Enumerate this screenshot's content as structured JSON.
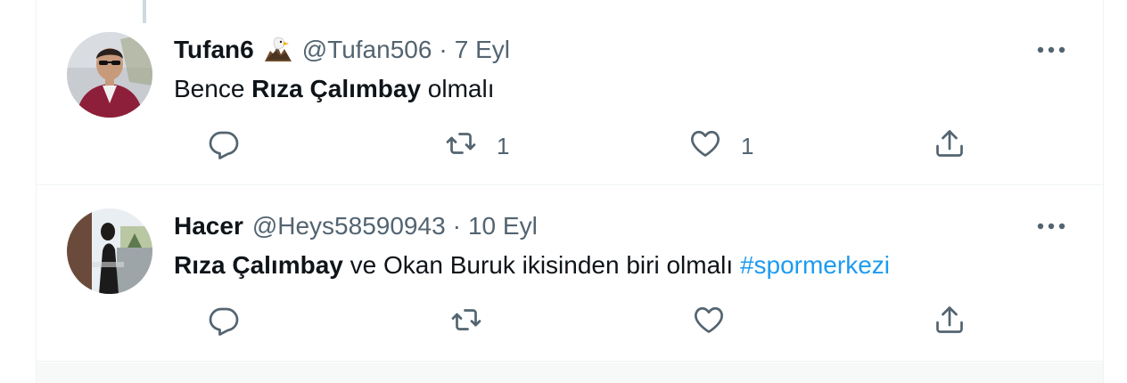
{
  "tweets": [
    {
      "name": "Tufan6",
      "handle": "@Tufan506",
      "separator": "·",
      "date": "7 Eyl",
      "text": {
        "pre": "Bence ",
        "bold": "Rıza Çalımbay",
        "post": " olmalı",
        "hashtag": ""
      },
      "actions": {
        "reply_count": "",
        "retweet_count": "1",
        "like_count": "1"
      },
      "emoji": "eagle-emoji"
    },
    {
      "name": "Hacer",
      "handle": "@Heys58590943",
      "separator": "·",
      "date": "10 Eyl",
      "text": {
        "pre": "",
        "bold": "Rıza Çalımbay",
        "post": " ve Okan Buruk ikisinden biri olmalı ",
        "hashtag": "#spormerkezi"
      },
      "actions": {
        "reply_count": "",
        "retweet_count": "",
        "like_count": ""
      }
    }
  ],
  "colors": {
    "text": "#0f1419",
    "secondary": "#536471",
    "link": "#1d9bf0",
    "border": "#eff3f4"
  },
  "icons": [
    "thread-line",
    "more-icon",
    "reply-icon",
    "retweet-icon",
    "like-icon",
    "share-icon",
    "eagle-emoji"
  ]
}
